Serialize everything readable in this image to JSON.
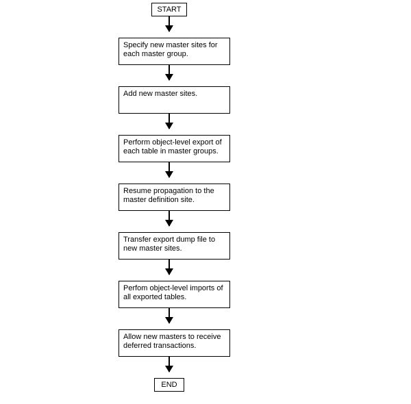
{
  "chart_data": {
    "type": "flowchart",
    "direction": "top-to-bottom",
    "nodes": [
      {
        "id": "start",
        "kind": "terminal",
        "label": "START"
      },
      {
        "id": "n1",
        "kind": "process",
        "label": "Specify new master sites for each master group."
      },
      {
        "id": "n2",
        "kind": "process",
        "label": "Add new master sites."
      },
      {
        "id": "n3",
        "kind": "process",
        "label": "Perform object-level export of each table in master groups."
      },
      {
        "id": "n4",
        "kind": "process",
        "label": "Resume propagation to the master definition site."
      },
      {
        "id": "n5",
        "kind": "process",
        "label": "Transfer export dump file to new master sites."
      },
      {
        "id": "n6",
        "kind": "process",
        "label": "Perfom object-level imports of all exported tables."
      },
      {
        "id": "n7",
        "kind": "process",
        "label": "Allow new masters to receive deferred transactions."
      },
      {
        "id": "end",
        "kind": "terminal",
        "label": "END"
      }
    ],
    "edges": [
      {
        "from": "start",
        "to": "n1"
      },
      {
        "from": "n1",
        "to": "n2"
      },
      {
        "from": "n2",
        "to": "n3"
      },
      {
        "from": "n3",
        "to": "n4"
      },
      {
        "from": "n4",
        "to": "n5"
      },
      {
        "from": "n5",
        "to": "n6"
      },
      {
        "from": "n6",
        "to": "n7"
      },
      {
        "from": "n7",
        "to": "end"
      }
    ]
  }
}
